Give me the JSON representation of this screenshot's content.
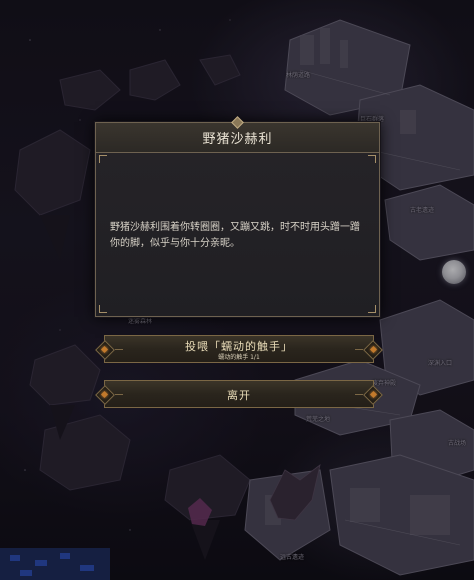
{
  "dialog": {
    "title": "野猪沙赫利",
    "body": "野猪沙赫利围着你转圈圈，又蹦又跳，时不时用头蹭一蹭你的脚，似乎与你十分亲昵。"
  },
  "choices": {
    "feed": {
      "label": "投喂「蠕动的触手」",
      "sub": "蠕动的触手 1/1"
    },
    "leave": {
      "label": "离开"
    }
  },
  "map_labels": {
    "top_center": "林荫道路",
    "top_right": "巨石群落",
    "right_upper": "古老遗迹",
    "right_mid": "深渊入口",
    "left_mid": "迷雾森林",
    "right_lower1": "废弃神殿",
    "right_lower2": "荒芜之地",
    "right_lower3": "古战场",
    "bottom_center": "远古遗迹"
  },
  "colors": {
    "accent_gold": "#7b6745",
    "gem_orange": "#c37a2c",
    "panel_bg": "#222125",
    "title_text": "#e8e1d2"
  }
}
